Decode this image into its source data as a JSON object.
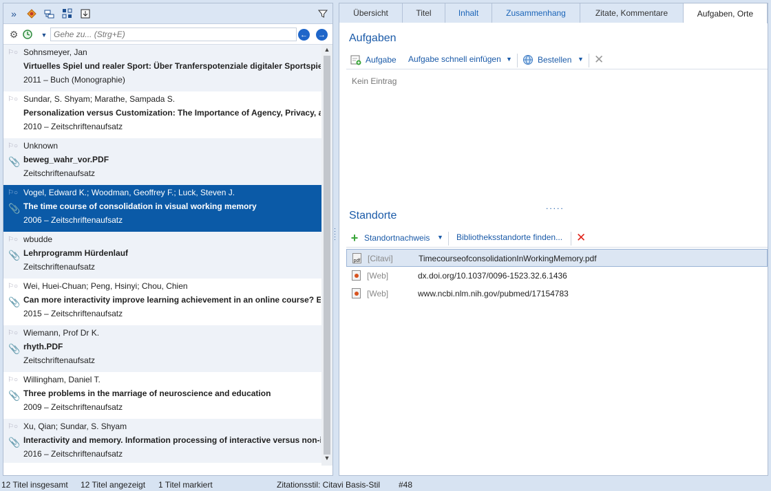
{
  "left_toolbar": {
    "icons": [
      "expand-icon",
      "task-icon",
      "folder-tree-icon",
      "grid-icon",
      "import-icon",
      "filter-icon"
    ]
  },
  "search": {
    "placeholder": "Gehe zu... (Strg+E)"
  },
  "references": [
    {
      "authors": "Sohnsmeyer, Jan",
      "title": "Virtuelles Spiel und realer Sport: Über Tranferspotenziale digitaler Sportspiel",
      "meta": "2011 – Buch (Monographie)",
      "attachment": false
    },
    {
      "authors": "Sundar, S. Shyam; Marathe, Sampada S.",
      "title": "Personalization versus Customization: The Importance of Agency, Privacy, and",
      "meta": "2010 – Zeitschriftenaufsatz",
      "attachment": false
    },
    {
      "authors": "Unknown",
      "title": "beweg_wahr_vor.PDF",
      "meta": "Zeitschriftenaufsatz",
      "attachment": true
    },
    {
      "authors": "Vogel, Edward K.; Woodman, Geoffrey F.; Luck, Steven J.",
      "title": "The time course of consolidation in visual working memory",
      "meta": "2006 – Zeitschriftenaufsatz",
      "attachment": true,
      "selected": true
    },
    {
      "authors": "wbudde",
      "title": "Lehrprogramm Hürdenlauf",
      "meta": "Zeitschriftenaufsatz",
      "attachment": true
    },
    {
      "authors": "Wei, Huei-Chuan; Peng, Hsinyi; Chou, Chien",
      "title": "Can more interactivity improve learning achievement in an online course? Eff",
      "meta": "2015 – Zeitschriftenaufsatz",
      "attachment": true
    },
    {
      "authors": "Wiemann, Prof Dr K.",
      "title": "rhyth.PDF",
      "meta": "Zeitschriftenaufsatz",
      "attachment": true
    },
    {
      "authors": "Willingham, Daniel T.",
      "title": "Three problems in the marriage of neuroscience and education",
      "meta": "2009 – Zeitschriftenaufsatz",
      "attachment": true
    },
    {
      "authors": "Xu, Qian; Sundar, S. Shyam",
      "title": "Interactivity and memory. Information processing of interactive versus non-i",
      "meta": "2016 – Zeitschriftenaufsatz",
      "attachment": true
    }
  ],
  "tabs": [
    "Übersicht",
    "Titel",
    "Inhalt",
    "Zusammenhang",
    "Zitate, Kommentare",
    "Aufgaben, Orte"
  ],
  "tasks": {
    "heading": "Aufgaben",
    "add_label": "Aufgabe",
    "quick_add_label": "Aufgabe schnell einfügen",
    "order_label": "Bestellen",
    "empty_text": "Kein Eintrag"
  },
  "splitter_dots": ".....",
  "locations": {
    "heading": "Standorte",
    "add_label": "Standortnachweis",
    "find_label": "Bibliotheksstandorte finden...",
    "items": [
      {
        "type": "[Citavi]",
        "address": "TimecourseofconsolidationInWorkingMemory.pdf",
        "icon": "pdf-file-icon",
        "selected": true
      },
      {
        "type": "[Web]",
        "address": "dx.doi.org/10.1037/0096-1523.32.6.1436",
        "icon": "web-file-icon"
      },
      {
        "type": "[Web]",
        "address": "www.ncbi.nlm.nih.gov/pubmed/17154783",
        "icon": "web-file-icon"
      }
    ]
  },
  "status": {
    "total": "12 Titel insgesamt",
    "shown": "12 Titel angezeigt",
    "marked": "1 Titel markiert",
    "style": "Zitationsstil: Citavi Basis-Stil",
    "number": "#48"
  },
  "colors": {
    "selection": "#0b5aa7",
    "accent": "#1a5aa8",
    "delete": "#e0241b"
  }
}
